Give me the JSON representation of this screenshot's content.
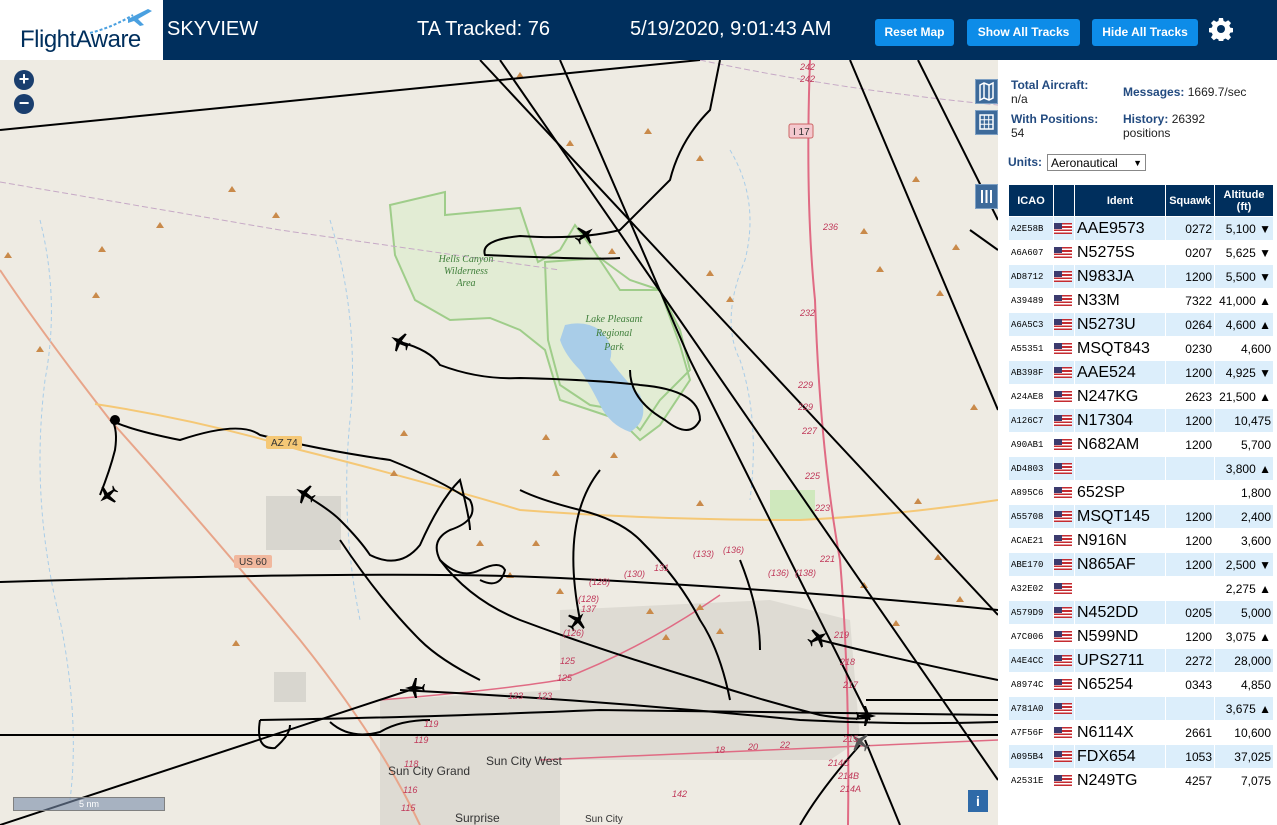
{
  "header": {
    "logo_text": "FlightAware",
    "app_name": "SKYVIEW",
    "ta_tracked_label": "TA Tracked: 76",
    "datetime": "5/19/2020, 9:01:43 AM",
    "buttons": {
      "reset_map": "Reset Map",
      "show_all_tracks": "Show All Tracks",
      "hide_all_tracks": "Hide All Tracks"
    }
  },
  "map": {
    "zoom_in": "+",
    "zoom_out": "−",
    "scale_label": "5 nm",
    "info_label": "i",
    "labels": {
      "hells_canyon_1": "Hells Canyon",
      "hells_canyon_2": "Wilderness",
      "hells_canyon_3": "Area",
      "lake_pleasant_1": "Lake Pleasant",
      "lake_pleasant_2": "Regional",
      "lake_pleasant_3": "Park",
      "az74": "AZ 74",
      "us60": "US 60",
      "i17": "I 17",
      "sun_city_grand": "Sun City Grand",
      "sun_city_west": "Sun City West",
      "surprise": "Surprise",
      "sun_city": "Sun City",
      "r242a": "242",
      "r242b": "242",
      "r236": "236",
      "r232": "232",
      "r229a": "229",
      "r229b": "229",
      "r227": "227",
      "r225": "225",
      "r223": "223",
      "r221": "221",
      "r219": "219",
      "r218": "218",
      "r217": "217",
      "r215": "215",
      "r214c": "214C",
      "r214b": "214B",
      "r214a": "214A",
      "r133": "(133)",
      "r136a": "(136)",
      "r131": "131",
      "r130": "(130)",
      "r128a": "(128)",
      "r128b": "(128)",
      "r137": "137",
      "r126": "(126)",
      "r125a": "125",
      "r125b": "125",
      "r123a": "123",
      "r123b": "123",
      "r119a": "119",
      "r119b": "119",
      "r118": "118",
      "r116": "116",
      "r115": "115",
      "r142": "142",
      "r136b": "(136)",
      "r138": "(138)",
      "r18": "18",
      "r20": "20",
      "r22": "22"
    }
  },
  "panel": {
    "total_aircraft_label": "Total Aircraft:",
    "total_aircraft_value": "n/a",
    "messages_label": "Messages:",
    "messages_value": "1669.7/sec",
    "with_positions_label": "With Positions:",
    "with_positions_value": "54",
    "history_label": "History:",
    "history_value": "26392",
    "history_unit": "positions",
    "units_label": "Units:",
    "units_value": "Aeronautical",
    "columns": {
      "icao": "ICAO",
      "ident": "Ident",
      "squawk": "Squawk",
      "altitude_1": "Altitude",
      "altitude_2": "(ft)"
    },
    "rows": [
      {
        "icao": "A2E58B",
        "ident": "AAE9573",
        "squawk": "0272",
        "alt": "5,100 ▼"
      },
      {
        "icao": "A6A607",
        "ident": "N5275S",
        "squawk": "0207",
        "alt": "5,625 ▼"
      },
      {
        "icao": "AD8712",
        "ident": "N983JA",
        "squawk": "1200",
        "alt": "5,500 ▼"
      },
      {
        "icao": "A39489",
        "ident": "N33M",
        "squawk": "7322",
        "alt": "41,000 ▲"
      },
      {
        "icao": "A6A5C3",
        "ident": "N5273U",
        "squawk": "0264",
        "alt": "4,600 ▲"
      },
      {
        "icao": "A55351",
        "ident": "MSQT843",
        "squawk": "0230",
        "alt": "4,600"
      },
      {
        "icao": "AB398F",
        "ident": "AAE524",
        "squawk": "1200",
        "alt": "4,925 ▼"
      },
      {
        "icao": "A24AE8",
        "ident": "N247KG",
        "squawk": "2623",
        "alt": "21,500 ▲"
      },
      {
        "icao": "A126C7",
        "ident": "N17304",
        "squawk": "1200",
        "alt": "10,475"
      },
      {
        "icao": "A90AB1",
        "ident": "N682AM",
        "squawk": "1200",
        "alt": "5,700"
      },
      {
        "icao": "AD4803",
        "ident": "",
        "squawk": "",
        "alt": "3,800 ▲"
      },
      {
        "icao": "A895C6",
        "ident": "652SP",
        "squawk": "",
        "alt": "1,800"
      },
      {
        "icao": "A55708",
        "ident": "MSQT145",
        "squawk": "1200",
        "alt": "2,400"
      },
      {
        "icao": "ACAE21",
        "ident": "N916N",
        "squawk": "1200",
        "alt": "3,600"
      },
      {
        "icao": "ABE170",
        "ident": "N865AF",
        "squawk": "1200",
        "alt": "2,500 ▼"
      },
      {
        "icao": "A32E02",
        "ident": "",
        "squawk": "",
        "alt": "2,275 ▲"
      },
      {
        "icao": "A579D9",
        "ident": "N452DD",
        "squawk": "0205",
        "alt": "5,000"
      },
      {
        "icao": "A7C006",
        "ident": "N599ND",
        "squawk": "1200",
        "alt": "3,075 ▲"
      },
      {
        "icao": "A4E4CC",
        "ident": "UPS2711",
        "squawk": "2272",
        "alt": "28,000"
      },
      {
        "icao": "A8974C",
        "ident": "N65254",
        "squawk": "0343",
        "alt": "4,850"
      },
      {
        "icao": "A781A0",
        "ident": "",
        "squawk": "",
        "alt": "3,675 ▲"
      },
      {
        "icao": "A7F56F",
        "ident": "N6114X",
        "squawk": "2661",
        "alt": "10,600"
      },
      {
        "icao": "A095B4",
        "ident": "FDX654",
        "squawk": "1053",
        "alt": "37,025"
      },
      {
        "icao": "A2531E",
        "ident": "N249TG",
        "squawk": "4257",
        "alt": "7,075"
      }
    ]
  },
  "colors": {
    "header_bg": "#002f5d",
    "button_bg": "#0d8ce8",
    "map_bg": "#eeebe3",
    "row_alt_bg": "#dceefb",
    "water": "#a9cde8",
    "park_border": "#9fcd8a",
    "track": "#000000"
  }
}
